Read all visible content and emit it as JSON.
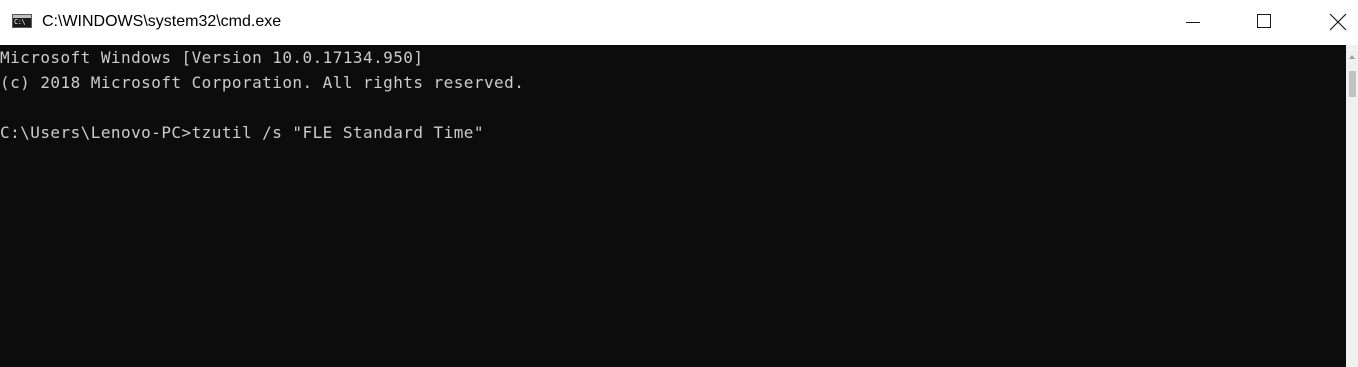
{
  "window": {
    "title": "C:\\WINDOWS\\system32\\cmd.exe",
    "icon": "cmd-icon",
    "icon_glyph": "C:\\",
    "controls": {
      "minimize": "minimize-icon",
      "maximize": "maximize-icon",
      "close": "close-icon"
    }
  },
  "console": {
    "lines": [
      "Microsoft Windows [Version 10.0.17134.950]",
      "(c) 2018 Microsoft Corporation. All rights reserved.",
      "",
      "C:\\Users\\Lenovo-PC>tzutil /s \"FLE Standard Time\""
    ],
    "background": "#0c0c0c",
    "foreground": "#cccccc"
  }
}
